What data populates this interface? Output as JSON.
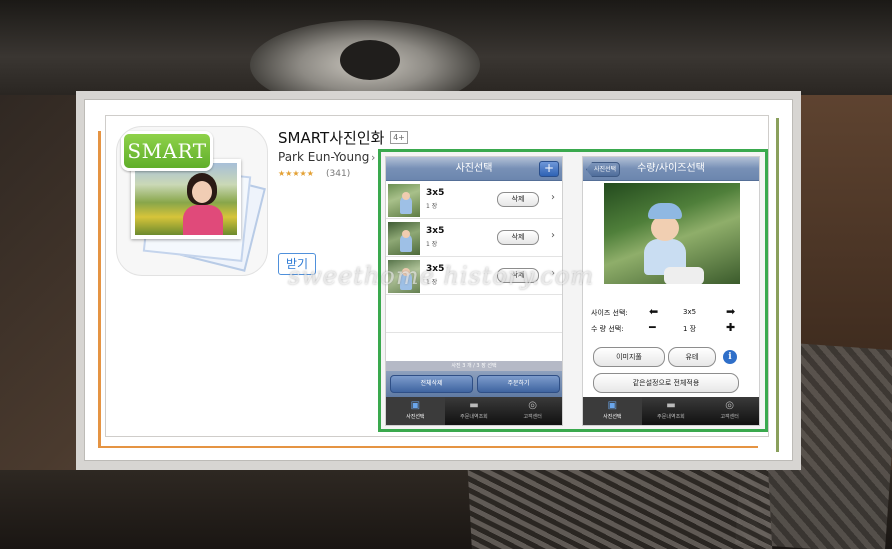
{
  "app": {
    "title": "SMART사진인화",
    "age_rating": "4+",
    "developer": "Park Eun-Young",
    "stars": "★★★★★",
    "rating_count": "(341)",
    "get_label": "받기",
    "icon_badge": "SMART"
  },
  "screen1": {
    "nav_title": "사진선택",
    "add_label": "+",
    "rows": [
      {
        "size": "3x5",
        "count": "1 장",
        "delete_label": "삭제"
      },
      {
        "size": "3x5",
        "count": "1 장",
        "delete_label": "삭제"
      },
      {
        "size": "3x5",
        "count": "1 장",
        "delete_label": "삭제"
      }
    ],
    "status_text": "사진 3 개 / 3 장 선택",
    "delete_all_label": "전체삭제",
    "order_label": "주문하기"
  },
  "screen2": {
    "back_label": "사진선택",
    "nav_title": "수량/사이즈선택",
    "size_label": "사이즈 선택:",
    "size_value": "3x5",
    "qty_label": "수 량 선택:",
    "qty_value": "1 장",
    "image_fill_label": "이미지풀",
    "matte_label": "유테",
    "info_label": "i",
    "apply_all_label": "같은설정으로 전체적용"
  },
  "tabbar": {
    "tabs": [
      "사진선택",
      "주문내역조회",
      "고객센터"
    ]
  },
  "watermark": "sweethome history.com",
  "colors": {
    "frame_green": "#3aa94e",
    "accent_orange": "#e59443",
    "get_blue": "#2f7bd4",
    "star_gold": "#e3a033",
    "nav_blue": "#6c86ae"
  }
}
